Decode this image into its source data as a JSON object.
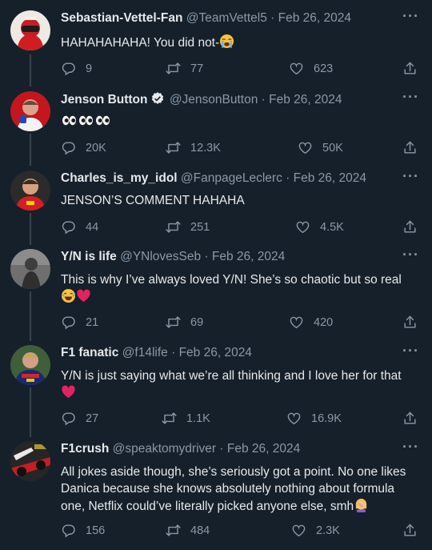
{
  "tweets": [
    {
      "name": "Sebastian-Vettel-Fan",
      "handle": "@TeamVettel5",
      "separator": "·",
      "date": "Feb 26, 2024",
      "text": "HAHAHAHAHA! You did not-",
      "emoji": [
        "loudly-crying-face"
      ],
      "verified": false,
      "replies": "9",
      "retweets": "77",
      "likes": "623",
      "avatar": "red-racing-helmet-avatar"
    },
    {
      "name": "Jenson Button",
      "handle": "@JensonButton",
      "separator": "·",
      "date": "Feb 26, 2024",
      "text": "",
      "emoji": [
        "eyes",
        "eyes",
        "eyes"
      ],
      "verified": true,
      "replies": "20K",
      "retweets": "12.3K",
      "likes": "50K",
      "avatar": "man-with-mic-avatar"
    },
    {
      "name": "Charles_is_my_idol",
      "handle": "@FanpageLeclerc",
      "separator": "·",
      "date": "Feb 26, 2024",
      "text": "JENSON’S COMMENT HAHAHA",
      "emoji": [],
      "verified": false,
      "replies": "44",
      "retweets": "251",
      "likes": "4.5K",
      "avatar": "red-driver-avatar"
    },
    {
      "name": "Y/N is life",
      "handle": "@YNlovesSeb",
      "separator": "·",
      "date": "Feb 26, 2024",
      "text": "This is why I’ve always loved Y/N! She’s so chaotic but so real",
      "emoji": [
        "tears-of-joy",
        "red-heart"
      ],
      "verified": false,
      "replies": "21",
      "retweets": "69",
      "likes": "420",
      "avatar": "grey-portrait-avatar"
    },
    {
      "name": "F1 fanatic",
      "handle": "@f14life",
      "separator": "·",
      "date": "Feb 26, 2024",
      "text": "Y/N is just saying what we’re all thinking and I love her for that",
      "emoji": [
        "red-heart"
      ],
      "verified": false,
      "replies": "27",
      "retweets": "1.1K",
      "likes": "16.9K",
      "avatar": "blue-driver-avatar"
    },
    {
      "name": "F1crush",
      "handle": "@speaktomydriver",
      "separator": "·",
      "date": "Feb 26, 2024",
      "text": "All jokes aside though, she’s seriously got a point. No one likes Danica because she knows absolutely nothing about formula one, Netflix could’ve literally picked anyone else, smh",
      "emoji": [
        "woman-facepalming"
      ],
      "verified": false,
      "replies": "156",
      "retweets": "484",
      "likes": "2.3K",
      "avatar": "race-car-avatar"
    }
  ],
  "colors": {
    "background": "#15202b",
    "text": "#e7e9ea",
    "muted": "#8b98a5",
    "thread": "#38444d",
    "verified": "#e7e9ea"
  },
  "icons": {
    "reply": "reply-icon",
    "retweet": "retweet-icon",
    "like": "heart-icon",
    "share": "share-icon",
    "more": "more-options-icon"
  }
}
